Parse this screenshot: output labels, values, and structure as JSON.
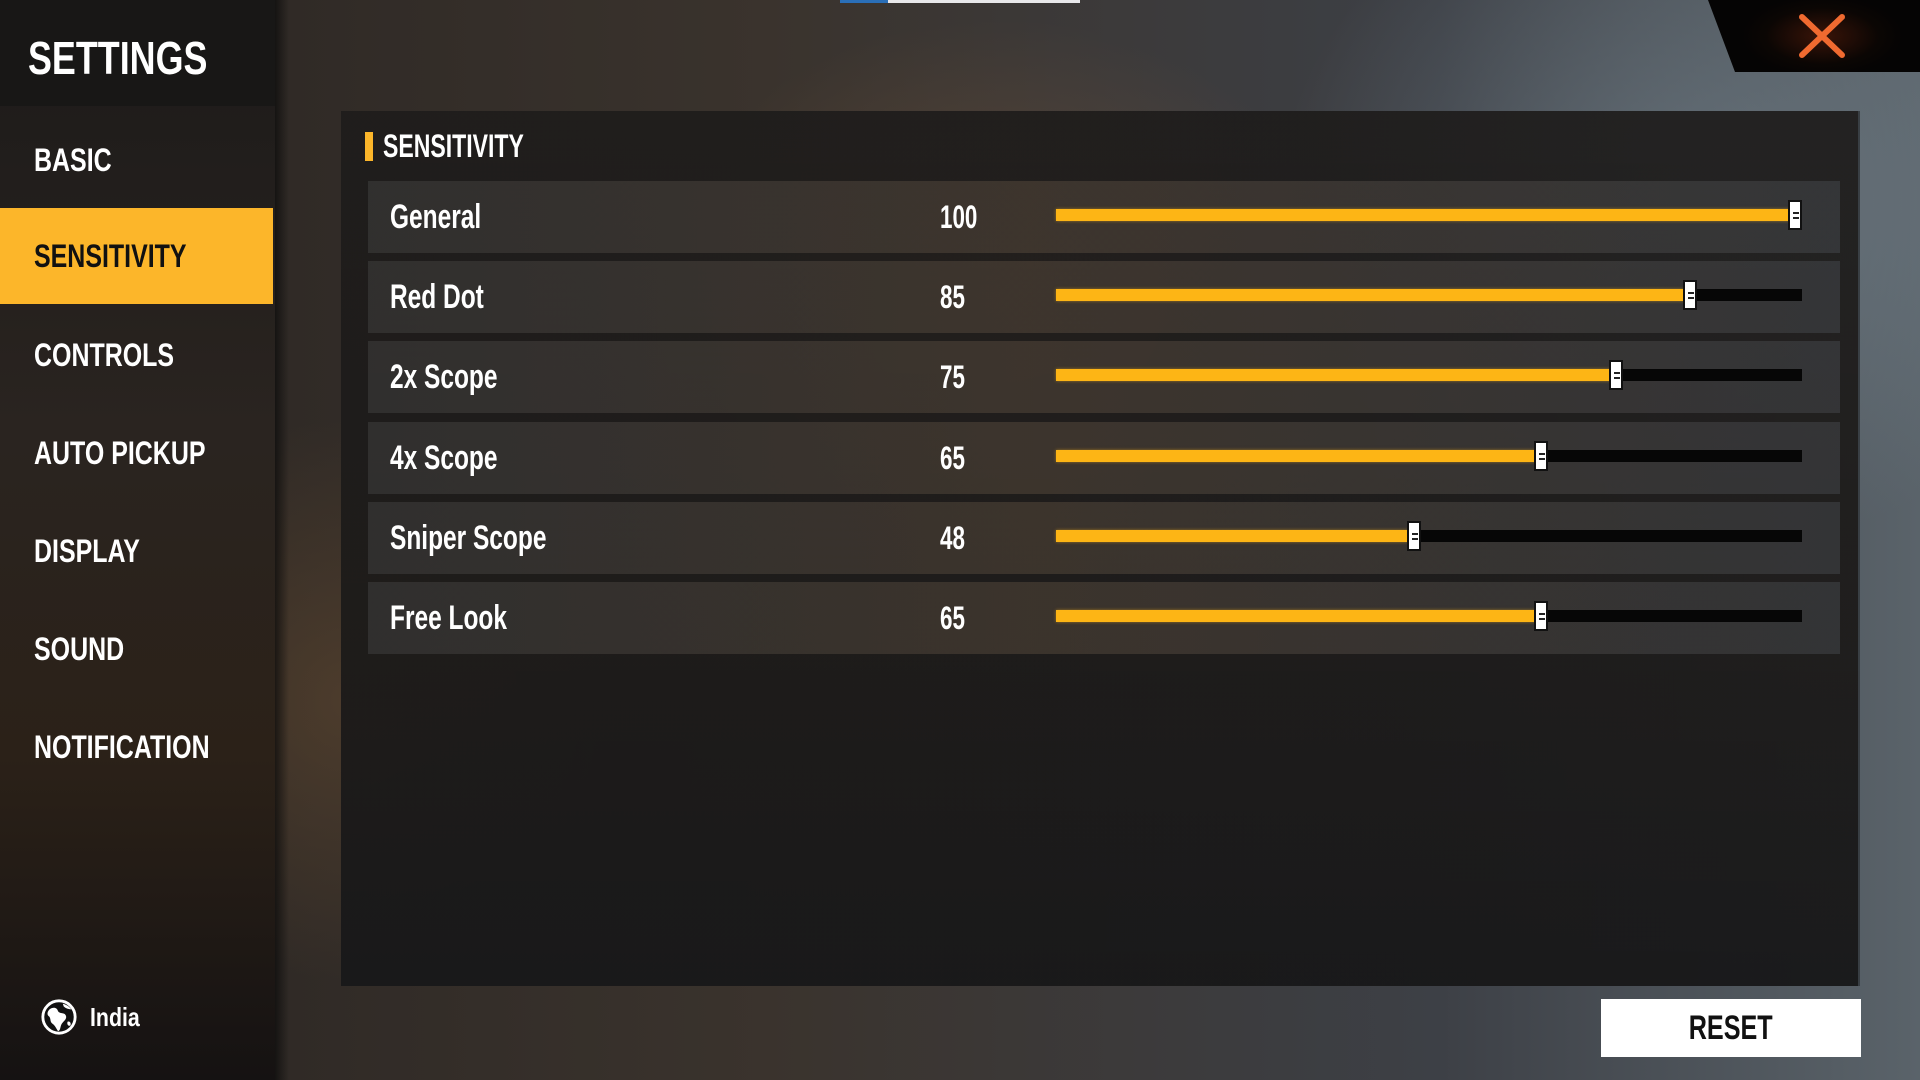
{
  "sidebar": {
    "title": "SETTINGS",
    "items": [
      {
        "label": "BASIC",
        "active": false
      },
      {
        "label": "SENSITIVITY",
        "active": true
      },
      {
        "label": "CONTROLS",
        "active": false
      },
      {
        "label": "AUTO PICKUP",
        "active": false
      },
      {
        "label": "DISPLAY",
        "active": false
      },
      {
        "label": "SOUND",
        "active": false
      },
      {
        "label": "NOTIFICATION",
        "active": false
      }
    ],
    "region": {
      "icon": "globe-icon",
      "label": "India"
    }
  },
  "close": {
    "icon": "close-icon",
    "color": "#f06a30"
  },
  "panel": {
    "section_title": "SENSITIVITY",
    "sliders": [
      {
        "label": "General",
        "value": "100",
        "percent": 100
      },
      {
        "label": "Red Dot",
        "value": "85",
        "percent": 85
      },
      {
        "label": "2x Scope",
        "value": "75",
        "percent": 75
      },
      {
        "label": "4x Scope",
        "value": "65",
        "percent": 65
      },
      {
        "label": "Sniper Scope",
        "value": "48",
        "percent": 48
      },
      {
        "label": "Free Look",
        "value": "65",
        "percent": 65
      }
    ]
  },
  "footer": {
    "reset_label": "RESET"
  },
  "colors": {
    "accent": "#fcb62a",
    "slider_fill": "#fdb515",
    "track": "#060606"
  }
}
